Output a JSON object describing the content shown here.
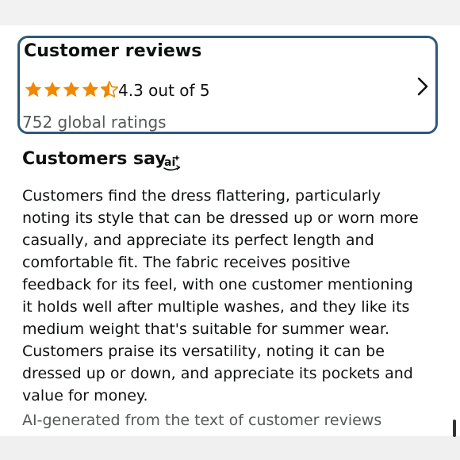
{
  "reviews": {
    "title": "Customer reviews",
    "rating": 4.3,
    "rating_max": 5,
    "rating_text": "4.3 out of 5",
    "ratings_count": "752 global ratings",
    "star_color": "#f08804",
    "chevron_icon": "chevron-right-icon"
  },
  "customers_say": {
    "title": "Customers say",
    "ai_icon": "ai-icon",
    "summary": "Customers find the dress flattering, particularly\nnoting its style that can be dressed up or worn more\ncasually, and appreciate its perfect length and\ncomfortable fit. The fabric receives positive\nfeedback for its feel, with one customer mentioning\nit holds well after multiple washes, and they like its\nmedium weight that's suitable for summer wear.\nCustomers praise its versatility, noting it can be\ndressed up or down, and appreciate its pockets and\nvalue for money.",
    "footnote": "AI-generated from the text of customer reviews"
  },
  "colors": {
    "card_border": "#2d5a78",
    "secondary_text": "#565959"
  }
}
